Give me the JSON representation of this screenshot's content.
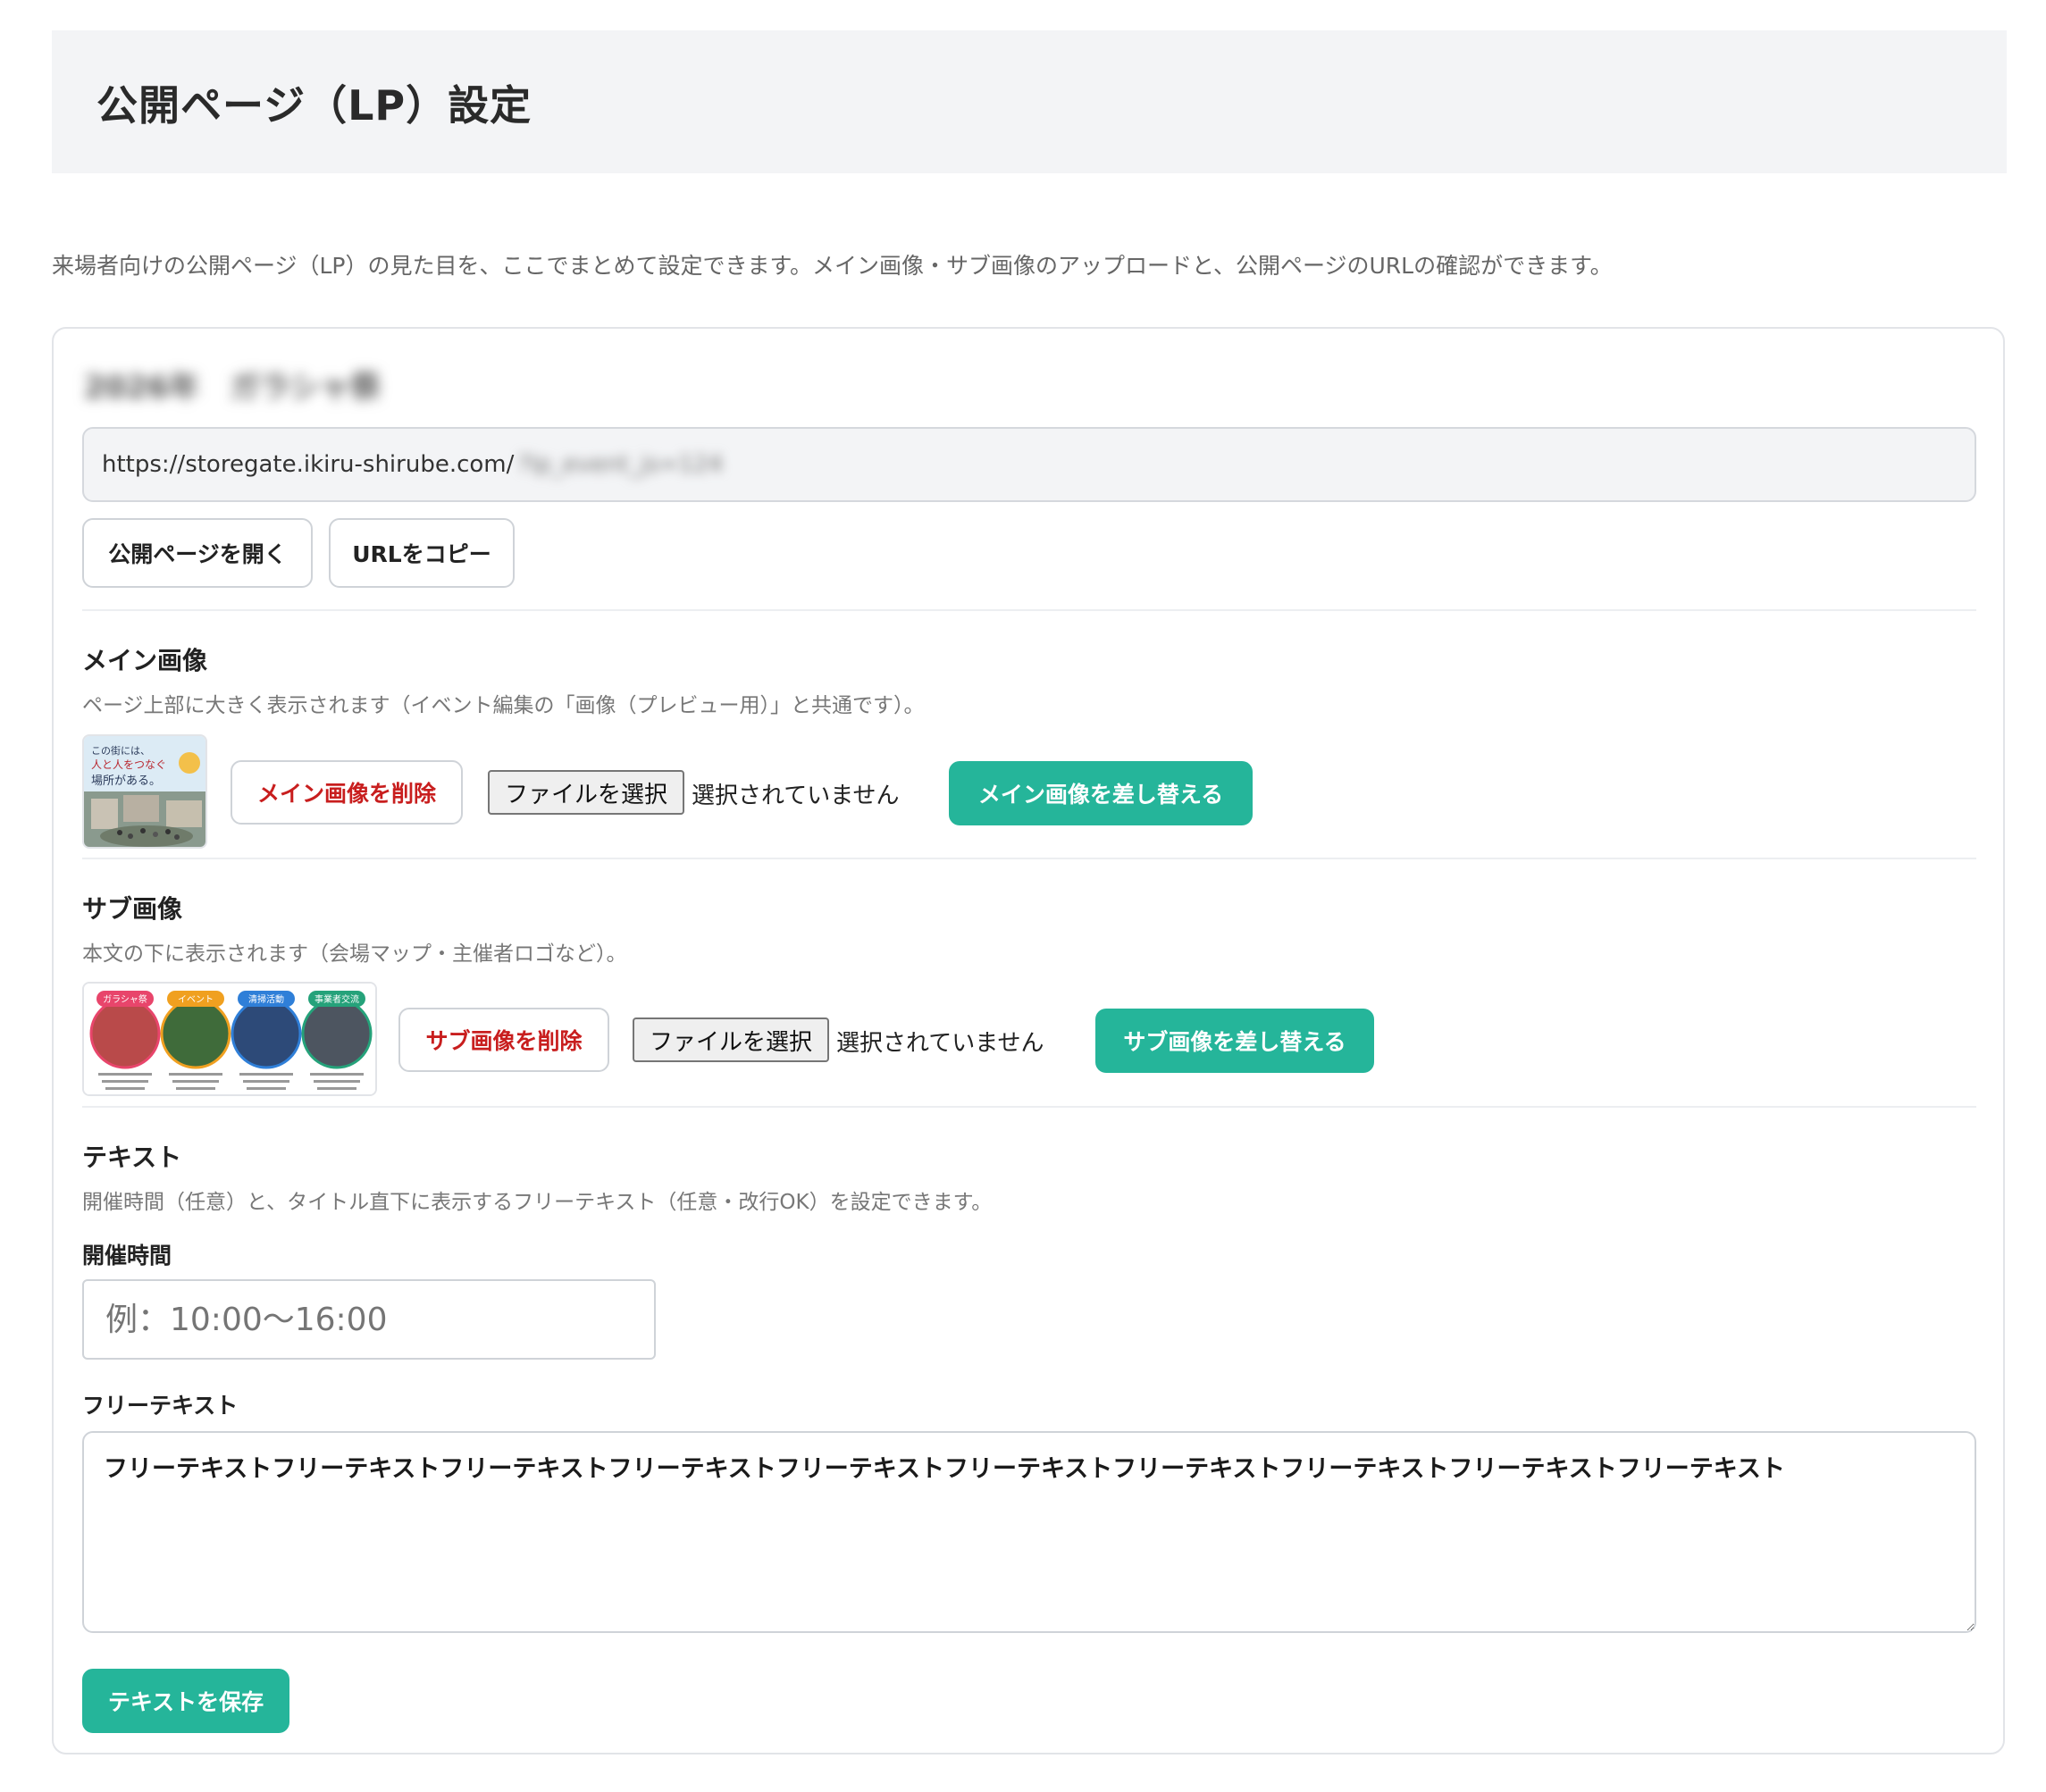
{
  "header": {
    "title": "公開ページ（LP）設定"
  },
  "intro": "来場者向けの公開ページ（LP）の見た目を、ここでまとめて設定できます。メイン画像・サブ画像のアップロードと、公開ページのURLの確認ができます。",
  "event": {
    "title": "2026年　ガラシャ祭",
    "url_prefix": "https://storegate.ikiru-shirube.com/",
    "url_suffix": "?lp_event_js=124",
    "open_button": "公開ページを開く",
    "copy_button": "URLをコピー"
  },
  "main_image": {
    "title": "メイン画像",
    "description": "ページ上部に大きく表示されます（イベント編集の「画像（プレビュー用）」と共通です）。",
    "delete_button": "メイン画像を削除",
    "file_button": "ファイルを選択",
    "file_status": "選択されていません",
    "replace_button": "メイン画像を差し替える",
    "thumb_text_1": "この街には、",
    "thumb_text_2": "人と人をつなぐ",
    "thumb_text_3": "場所がある。"
  },
  "sub_image": {
    "title": "サブ画像",
    "description": "本文の下に表示されます（会場マップ・主催者ロゴなど）。",
    "delete_button": "サブ画像を削除",
    "file_button": "ファイルを選択",
    "file_status": "選択されていません",
    "replace_button": "サブ画像を差し替える",
    "circles": [
      {
        "label": "ガラシャ祭",
        "color": "#e8456b"
      },
      {
        "label": "イベント",
        "color": "#f0a020"
      },
      {
        "label": "清掃活動",
        "color": "#2f7fd8"
      },
      {
        "label": "事業者交流",
        "color": "#25a27a"
      }
    ]
  },
  "text_section": {
    "title": "テキスト",
    "description": "開催時間（任意）と、タイトル直下に表示するフリーテキスト（任意・改行OK）を設定できます。",
    "time_label": "開催時間",
    "time_placeholder": "例：10:00〜16:00",
    "free_label": "フリーテキスト",
    "free_value": "フリーテキストフリーテキストフリーテキストフリーテキストフリーテキストフリーテキストフリーテキストフリーテキストフリーテキストフリーテキスト",
    "save_button": "テキストを保存"
  }
}
